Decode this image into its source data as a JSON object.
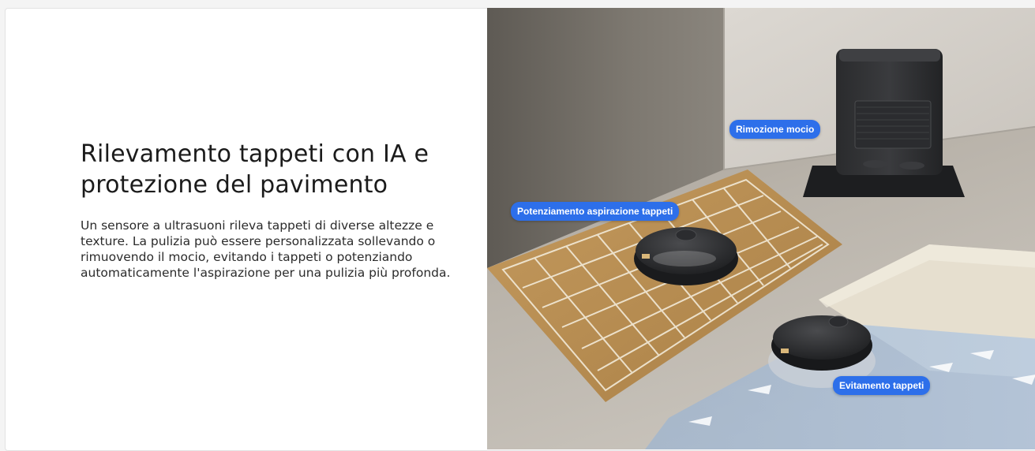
{
  "feature": {
    "title": "Rilevamento tappeti con IA e protezione del pavimento",
    "description": "Un sensore a ultrasuoni rileva tappeti di diverse altezze e texture. La pulizia può essere personalizzata sollevando o rimuovendo il mocio, evitando i tappeti o potenziando automaticamente l'aspirazione per una pulizia più profonda."
  },
  "image": {
    "tags": {
      "mop_removal": "Rimozione mocio",
      "carpet_boost": "Potenziamento aspirazione tappeti",
      "carpet_avoid": "Evitamento tappeti"
    }
  },
  "colors": {
    "tag_background": "#2d6fea",
    "title_text": "#1b1b1b",
    "body_text": "#2b2b2b"
  }
}
